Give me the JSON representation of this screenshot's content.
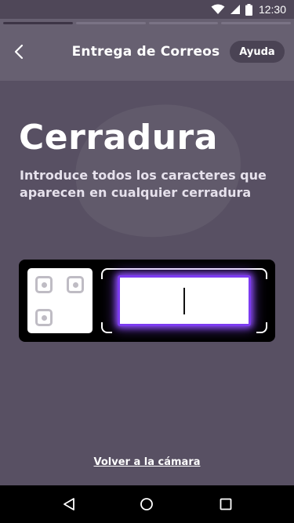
{
  "status_bar": {
    "time": "12:30",
    "icons": [
      "wifi-icon",
      "signal-icon",
      "battery-icon"
    ]
  },
  "header": {
    "title": "Entrega de Correos",
    "help_label": "Ayuda",
    "back_icon": "chevron-left-icon",
    "progress": {
      "segments": 4,
      "current": 1,
      "current_fill": 1.0
    }
  },
  "main": {
    "title": "Cerradura",
    "subtitle": "Introduce todos los caracteres que aparecen en cualquier cerradura",
    "code_input": {
      "value": "",
      "placeholder": ""
    }
  },
  "footer": {
    "link_label": "Volver a la cámara"
  },
  "nav": {
    "icons": [
      "back-triangle-icon",
      "home-circle-icon",
      "recents-square-icon"
    ]
  },
  "colors": {
    "background": "#585063",
    "header": "#676071",
    "accent": "#8b4cf5",
    "card": "#000000"
  }
}
